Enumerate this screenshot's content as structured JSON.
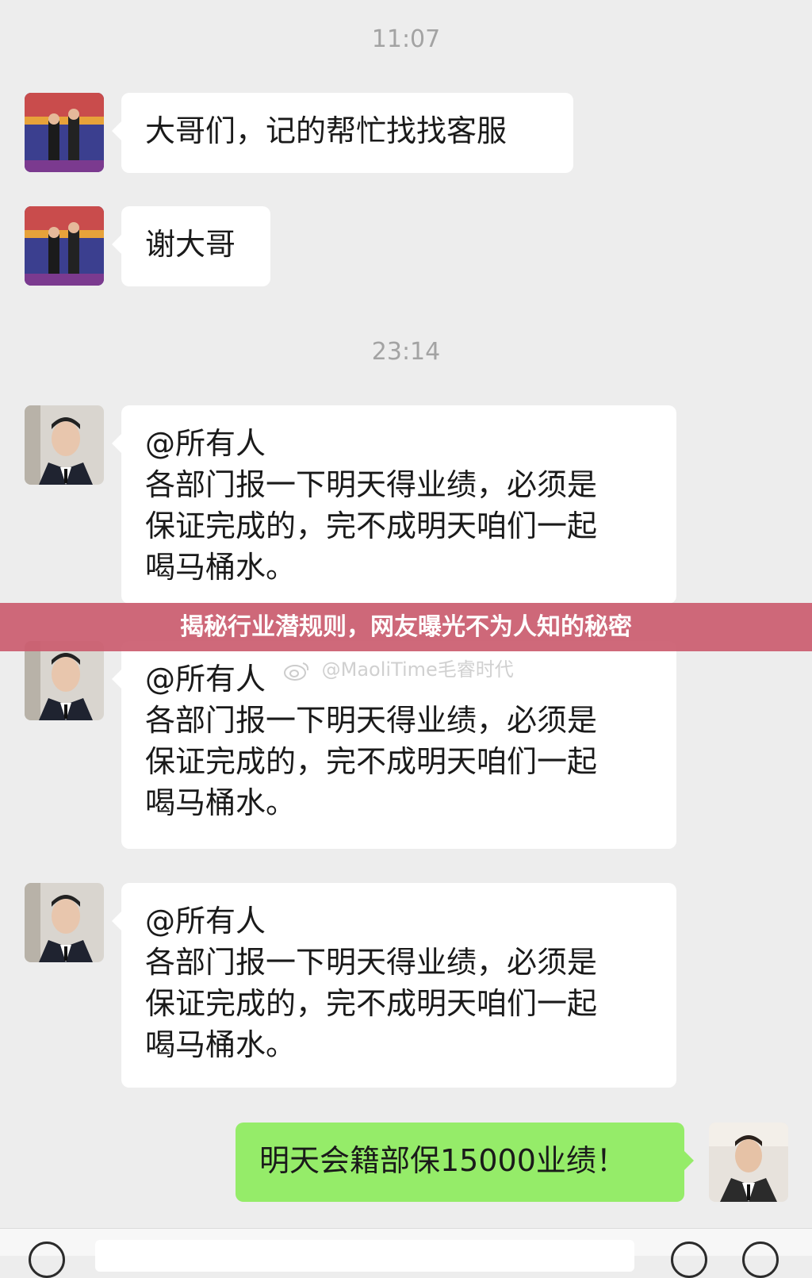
{
  "chat": {
    "timestamps": [
      "11:07",
      "23:14"
    ],
    "messages": [
      {
        "sender": "other",
        "avatar": "group-photo-avatar",
        "lines": [
          "大哥们，记的帮忙找找客服"
        ]
      },
      {
        "sender": "other",
        "avatar": "group-photo-avatar",
        "lines": [
          "谢大哥"
        ]
      },
      {
        "sender": "other",
        "avatar": "man-in-suit-avatar",
        "lines": [
          "@所有人",
          "各部门报一下明天得业绩，必须是",
          "保证完成的，完不成明天咱们一起",
          "喝马桶水。"
        ]
      },
      {
        "sender": "other",
        "avatar": "man-in-suit-avatar",
        "lines": [
          "@所有人",
          "各部门报一下明天得业绩，必须是",
          "保证完成的，完不成明天咱们一起",
          "喝马桶水。"
        ]
      },
      {
        "sender": "other",
        "avatar": "man-in-suit-avatar",
        "lines": [
          "@所有人",
          "各部门报一下明天得业绩，必须是",
          "保证完成的，完不成明天咱们一起",
          "喝马桶水。"
        ]
      },
      {
        "sender": "me",
        "avatar": "man-in-vest-avatar",
        "lines": [
          "明天会籍部保15000业绩！"
        ]
      }
    ]
  },
  "overlay": {
    "headline": "揭秘行业潜规则，网友曝光不为人知的秘密"
  },
  "watermark": {
    "text": "@MaoliTime毛睿时代",
    "icon": "weibo-icon"
  },
  "colors": {
    "background": "#ededed",
    "bubble_other": "#ffffff",
    "bubble_me": "#95ec69",
    "banner": "#cb5c6f",
    "timestamp": "#a3a3a3"
  }
}
